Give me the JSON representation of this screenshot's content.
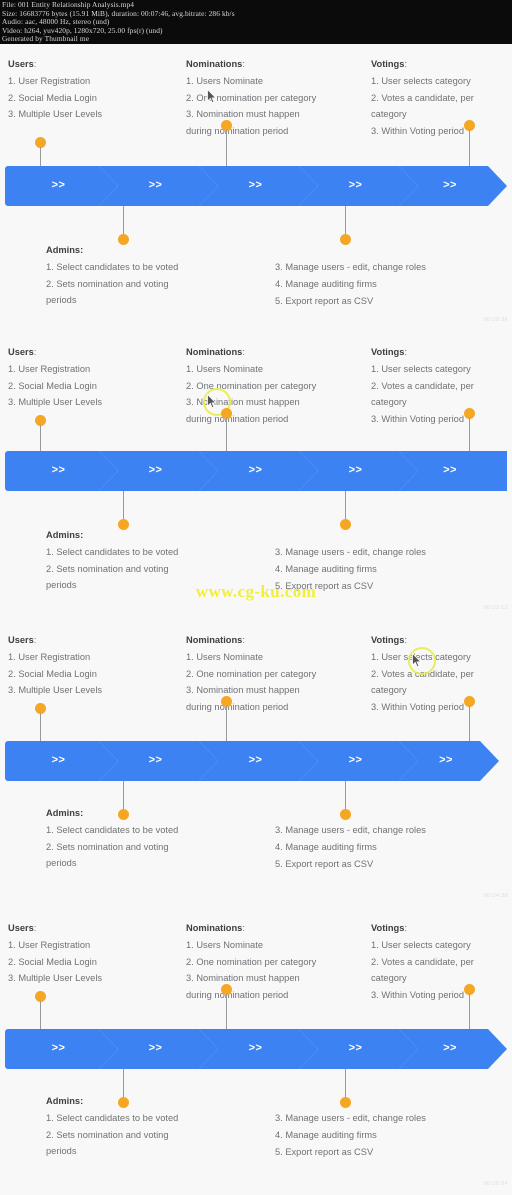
{
  "meta": {
    "line1": "File: 001 Entity Relationship Analysis.mp4",
    "line2": "Size: 16683776 bytes (15.91 MiB), duration: 00:07:46, avg.bitrate: 286 kb/s",
    "line3": "Audio: aac, 48000 Hz, stereo (und)",
    "line4": "Video: h264, yuv420p, 1280x720, 25.00 fps(r) (und)",
    "line5": "Generated by Thumbnail me"
  },
  "watermark": "www.cg-ku.com",
  "diagram": {
    "columns": [
      {
        "title": "Users",
        "colon": ":",
        "lines": [
          "1. User Registration",
          "2. Social Media Login",
          "3. Multiple User Levels"
        ]
      },
      {
        "title": "Nominations",
        "colon": ":",
        "lines": [
          "1. Users Nominate",
          "2. One nomination per category",
          "3. Nomination must happen",
          "during nomination period"
        ]
      },
      {
        "title": "Votings",
        "colon": ":",
        "lines": [
          "1. User selects category",
          "2. Votes a candidate, per",
          "category",
          "3. Within Voting period"
        ]
      }
    ],
    "chevrons": [
      {
        "label": ">>"
      },
      {
        "label": ">>"
      },
      {
        "label": ">>"
      },
      {
        "label": ">>"
      },
      {
        "label": ">>"
      }
    ],
    "bottom_columns": [
      {
        "title": "Admins",
        "colon": ":",
        "lines": [
          "1. Select candidates to be voted",
          "2. Sets nomination and voting",
          "periods"
        ]
      },
      {
        "title": "",
        "colon": "",
        "lines": [
          "3. Manage users - edit, change  roles",
          "4. Manage auditing firms",
          "5. Export report as CSV"
        ]
      }
    ]
  },
  "frames": [
    {
      "timestamp": "00:00:36"
    },
    {
      "timestamp": "00:03:12"
    },
    {
      "timestamp": "00:04:38"
    },
    {
      "timestamp": "00:06:04"
    }
  ]
}
